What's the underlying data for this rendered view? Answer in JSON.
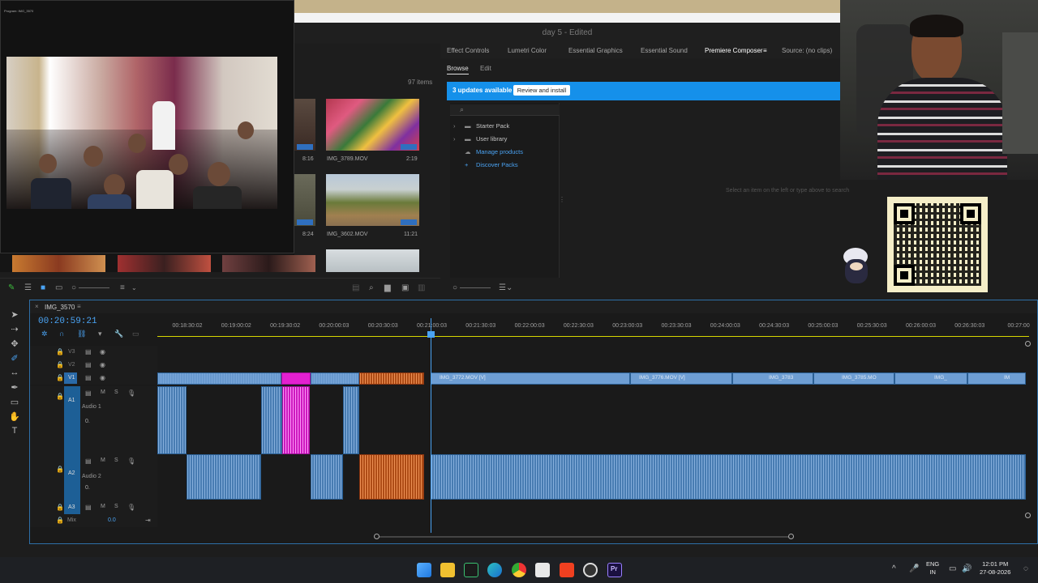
{
  "window": {
    "title": "day 5 - Edited"
  },
  "program_monitor": {
    "tiny_title": "Program: IMG_3570"
  },
  "project": {
    "items_count": "97 items",
    "clips": [
      {
        "name": "IMG_3789.MOV",
        "duration": "2:19",
        "left_duration": "8:16"
      },
      {
        "name": "IMG_3602.MOV",
        "duration": "11:21",
        "left_duration": "8:24"
      }
    ]
  },
  "panel_tabs": [
    {
      "label": "Effect Controls"
    },
    {
      "label": "Lumetri Color"
    },
    {
      "label": "Essential Graphics"
    },
    {
      "label": "Essential Sound"
    },
    {
      "label": "Premiere Composer"
    },
    {
      "label": "Source: (no clips)"
    }
  ],
  "composer": {
    "browse_label": "Browse",
    "edit_label": "Edit",
    "updates_text": "3 updates available",
    "review_button": "Review and install",
    "tree": [
      {
        "label": "Starter Pack",
        "icon": "folder-icon",
        "link": false
      },
      {
        "label": "User library",
        "icon": "folder-icon",
        "link": false
      },
      {
        "label": "Manage products",
        "icon": "cloud-icon",
        "link": true
      },
      {
        "label": "Discover Packs",
        "icon": "plus-icon",
        "link": true
      }
    ],
    "hint": "Select an item on the left or type above to search"
  },
  "timeline": {
    "sequence_name": "IMG_3570",
    "timecode": "00:20:59:21",
    "ruler_labels": [
      "00:18:30:02",
      "00:19:00:02",
      "00:19:30:02",
      "00:20:00:03",
      "00:20:30:03",
      "00:21:00:03",
      "00:21:30:03",
      "00:22:00:03",
      "00:22:30:03",
      "00:23:00:03",
      "00:23:30:03",
      "00:24:00:03",
      "00:24:30:03",
      "00:25:00:03",
      "00:25:30:03",
      "00:26:00:03",
      "00:26:30:03",
      "00:27:00"
    ],
    "tracks": {
      "v3": "V3",
      "v2": "V2",
      "v1": "V1",
      "a1": "A1",
      "a1_name": "Audio 1",
      "a2": "A2",
      "a2_name": "Audio 2",
      "a3": "A3",
      "mix": "Mix",
      "mix_value": "0.0",
      "a1_vol": "0.",
      "a2_vol": "0."
    },
    "clips_v1": [
      {
        "name": "IMG_3772.MOV [V]"
      },
      {
        "name": "IMG_3776.MOV [V]"
      },
      {
        "name": "IMG_3783"
      },
      {
        "name": "IMG_3785.MO"
      },
      {
        "name": "IMG_"
      },
      {
        "name": "IM"
      }
    ]
  },
  "taskbar": {
    "lang_top": "ENG",
    "lang_bottom": "IN",
    "time": "12:01 PM",
    "date": "27-08-2026"
  },
  "colors": {
    "accent": "#1590ea",
    "clip_video": "#6e9ed3",
    "clip_audio": "#4a7fb4",
    "clip_pink": "#e320d0",
    "clip_orange": "#c2551a",
    "timecode": "#4aa3f3"
  }
}
